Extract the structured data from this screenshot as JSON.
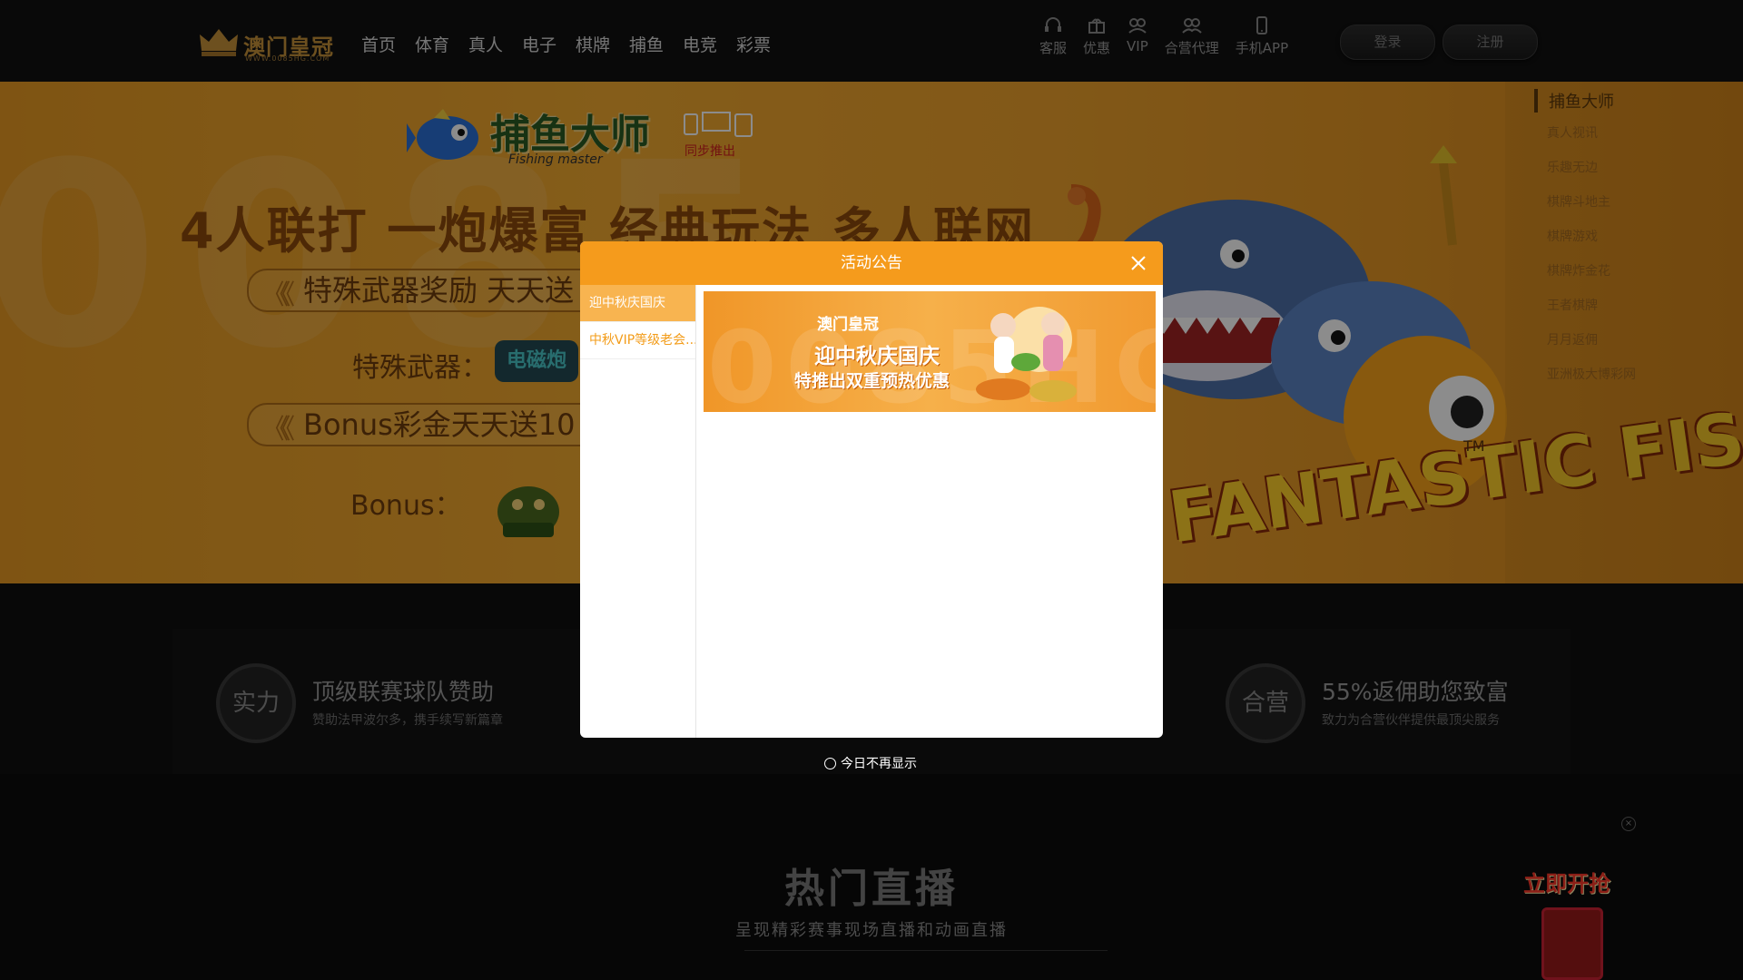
{
  "header": {
    "logo_text": "澳门皇冠",
    "logo_url": "WWW.0085HG.COM",
    "nav": [
      "首页",
      "体育",
      "真人",
      "电子",
      "棋牌",
      "捕鱼",
      "电竞",
      "彩票"
    ],
    "tools": [
      {
        "label": "客服",
        "icon": "headset-icon"
      },
      {
        "label": "优惠",
        "icon": "gift-icon"
      },
      {
        "label": "VIP",
        "icon": "vip-icon"
      },
      {
        "label": "合营代理",
        "icon": "agent-icon"
      },
      {
        "label": "手机APP",
        "icon": "mobile-icon"
      }
    ],
    "login_label": "登录",
    "register_label": "注册"
  },
  "banner": {
    "watermark": "0085",
    "game_title": "捕鱼大师",
    "game_subtitle": "Fishing master",
    "sync_text": "同步推出",
    "slogan": "4人联打 一炮爆富 经典玩法 多人联网",
    "promo1": "特殊武器奖励 天天送",
    "promo2_label": "特殊武器：",
    "weapon_name": "电磁炮",
    "promo3": "Bonus彩金天天送10",
    "promo4_label": "Bonus：",
    "fantastic_text": "FANTASTIC FISH",
    "tm": "TM",
    "side_menu": {
      "title": "捕鱼大师",
      "items": [
        "真人视讯",
        "乐趣无边",
        "棋牌斗地主",
        "棋牌游戏",
        "棋牌炸金花",
        "王者棋牌",
        "月月返佣",
        "亚洲极大博彩网"
      ]
    }
  },
  "features": [
    {
      "badge": "实力",
      "title": "顶级联赛球队赞助",
      "desc": "赞助法甲波尔多，携手续写新篇章"
    },
    {
      "badge": "合营",
      "title": "55%返佣助您致富",
      "desc": "致力为合营伙伴提供最顶尖服务"
    }
  ],
  "live": {
    "title": "热门直播",
    "subtitle": "呈现精彩赛事现场直播和动画直播"
  },
  "red_packet": {
    "label": "立即开抢",
    "close": "×"
  },
  "modal": {
    "title": "活动公告",
    "tabs": [
      "迎中秋庆国庆",
      "中秋VIP等级老会..."
    ],
    "promo": {
      "brand": "澳门皇冠",
      "watermark": "0085HG.COM",
      "line1": "迎中秋庆国庆",
      "line2": "特推出双重预热优惠"
    },
    "dont_show": "今日不再显示"
  },
  "colors": {
    "accent": "#f59b1c",
    "tab_active": "#f8b450",
    "banner": "#eda12c"
  }
}
